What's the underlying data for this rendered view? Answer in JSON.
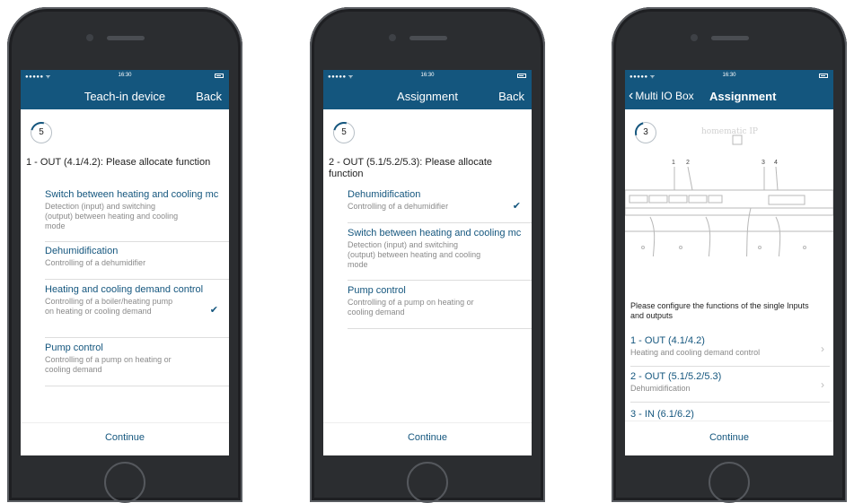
{
  "status": {
    "signal": "●●●●● ᯤ",
    "time": "16:30"
  },
  "phone1": {
    "title": "Teach-in device",
    "back": "Back",
    "step": "5",
    "heading": "1 - OUT (4.1/4.2): Please allocate function",
    "options": [
      {
        "title": "Switch between heating and cooling mc",
        "desc": "Detection (input) and switching (output) between heating and cooling mode",
        "checked": false
      },
      {
        "title": "Dehumidification",
        "desc": "Controlling of a dehumidifier",
        "checked": false
      },
      {
        "title": "Heating and cooling demand control",
        "desc": "Controlling of a boiler/heating pump on heating or cooling demand",
        "checked": true
      },
      {
        "title": "Pump control",
        "desc": "Controlling of a pump on heating or cooling demand",
        "checked": false
      }
    ],
    "continue": "Continue"
  },
  "phone2": {
    "title": "Assignment",
    "back": "Back",
    "step": "5",
    "heading": "2 - OUT (5.1/5.2/5.3): Please allocate function",
    "options": [
      {
        "title": "Dehumidification",
        "desc": "Controlling of a dehumidifier",
        "checked": true
      },
      {
        "title": "Switch between heating and cooling mc",
        "desc": "Detection (input) and switching (output) between heating and cooling mode",
        "checked": false
      },
      {
        "title": "Pump control",
        "desc": "Controlling of a pump on heating or cooling demand",
        "checked": false
      }
    ],
    "continue": "Continue"
  },
  "phone3": {
    "back_label": "Multi IO Box",
    "title": "Assignment",
    "step": "3",
    "logo": "homematic IP",
    "diagram_labels": [
      "1",
      "2",
      "3",
      "4"
    ],
    "configure_text": "Please configure the functions of the single Inputs and outputs",
    "rows": [
      {
        "title": "1 - OUT (4.1/4.2)",
        "desc": "Heating and cooling demand control"
      },
      {
        "title": "2 - OUT (5.1/5.2/5.3)",
        "desc": "Dehumidification"
      },
      {
        "title": "3 - IN (6.1/6.2)",
        "desc": ""
      }
    ],
    "continue": "Continue"
  },
  "icons": {
    "check": "checkmark-icon",
    "chevron_right": "chevron-right-icon",
    "chevron_left": "chevron-left-icon"
  },
  "colors": {
    "navbar": "#14567e",
    "link": "#14567e"
  }
}
